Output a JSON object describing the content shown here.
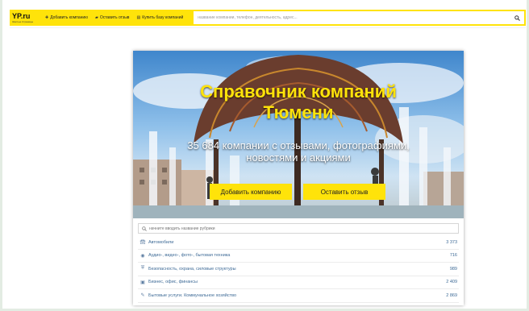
{
  "header": {
    "logo": {
      "text": "YP.ru",
      "subtext": "Желтые Страницы"
    },
    "nav": [
      {
        "label": "Добавить компанию",
        "icon": "plus-icon"
      },
      {
        "label": "Оставить отзыв",
        "icon": "comment-icon"
      },
      {
        "label": "Купить базу компаний",
        "icon": "database-icon"
      }
    ],
    "search": {
      "placeholder": "название компании, телефон, деятельность, адрес..."
    }
  },
  "hero": {
    "title_line1": "Справочник компаний",
    "title_line2": "Тюмени",
    "subtitle": "35 684 компании с отзывами, фотографиями, новостями и акциями",
    "add_company_label": "Добавить компанию",
    "leave_review_label": "Оставить отзыв"
  },
  "rubrics": {
    "search_placeholder": "начните вводить название рубрики",
    "items": [
      {
        "label": "Автомобили",
        "count": "3 373",
        "icon": "car-icon"
      },
      {
        "label": "Аудио-, видео-, фото-, бытовая техника",
        "count": "716",
        "icon": "camera-icon"
      },
      {
        "label": "Безопасность, охрана, силовые структуры",
        "count": "989",
        "icon": "shield-icon"
      },
      {
        "label": "Бизнес, офис, финансы",
        "count": "2 409",
        "icon": "briefcase-icon"
      },
      {
        "label": "Бытовые услуги. Коммунальное хозяйство",
        "count": "2 869",
        "icon": "wrench-icon"
      }
    ]
  },
  "colors": {
    "accent": "#ffe30a",
    "link": "#3d6a96"
  }
}
